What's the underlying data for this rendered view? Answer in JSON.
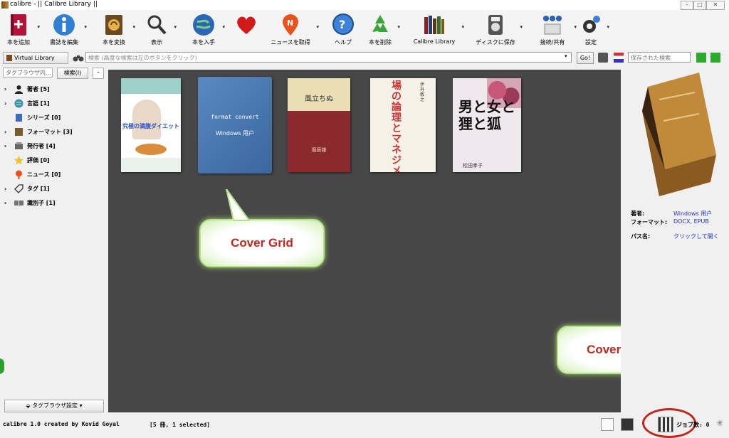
{
  "window": {
    "title": "calibre - || Calibre Library ||",
    "controls": [
      "–",
      "□",
      "✕"
    ]
  },
  "toolbar": {
    "items": [
      {
        "label": "本を追加",
        "icon": "add-book-icon"
      },
      {
        "label": "書誌を編集",
        "icon": "edit-metadata-icon"
      },
      {
        "label": "本を変換",
        "icon": "convert-book-icon"
      },
      {
        "label": "表示",
        "icon": "view-icon"
      },
      {
        "label": "本を入手",
        "icon": "get-books-icon"
      },
      {
        "label": "",
        "icon": "heart-icon"
      },
      {
        "label": "ニュースを取得",
        "icon": "fetch-news-icon"
      },
      {
        "label": "ヘルプ",
        "icon": "help-icon"
      },
      {
        "label": "本を削除",
        "icon": "remove-books-icon"
      },
      {
        "label": "Calibre Library",
        "icon": "library-icon"
      },
      {
        "label": "ディスクに保存",
        "icon": "save-to-disk-icon"
      },
      {
        "label": "接続/共有",
        "icon": "connect-share-icon"
      },
      {
        "label": "設定",
        "icon": "preferences-icon"
      }
    ]
  },
  "searchbar": {
    "virtual_library": "Virtual Library",
    "search_placeholder": "検索 (高度な検索は左のボタンをクリック)",
    "go": "Go!",
    "saved_searches": "保存された検索"
  },
  "tag_browser": {
    "find_placeholder": "タグブラウザ内...",
    "find_button": "検索(I)",
    "collapse": "-",
    "categories": [
      {
        "label": "著者",
        "count": "[5]",
        "expandable": true,
        "icon": "author-icon"
      },
      {
        "label": "言語",
        "count": "[1]",
        "expandable": true,
        "icon": "language-icon"
      },
      {
        "label": "シリーズ",
        "count": "[0]",
        "expandable": false,
        "icon": "series-icon"
      },
      {
        "label": "フォーマット",
        "count": "[3]",
        "expandable": true,
        "icon": "format-icon"
      },
      {
        "label": "発行者",
        "count": "[4]",
        "expandable": true,
        "icon": "publisher-icon"
      },
      {
        "label": "評価",
        "count": "[0]",
        "expandable": false,
        "icon": "rating-icon"
      },
      {
        "label": "ニュース",
        "count": "[0]",
        "expandable": false,
        "icon": "news-icon"
      },
      {
        "label": "タグ",
        "count": "[1]",
        "expandable": true,
        "icon": "tag-icon"
      },
      {
        "label": "識別子",
        "count": "[1]",
        "expandable": true,
        "icon": "identifier-icon"
      }
    ],
    "settings_button": "タグブラウザ設定"
  },
  "covers": [
    {
      "title": "究極の満腹ダイエット",
      "style": "photo-diet"
    },
    {
      "title": "format convert",
      "author": "Windows 用户",
      "style": "blue-placeholder"
    },
    {
      "title": "風立ちぬ",
      "author": "堀辰雄",
      "style": "red-classic"
    },
    {
      "title": "場の論理とマネジメント",
      "author": "伊丹敬之",
      "style": "beige-text"
    },
    {
      "title": "男と女と狸と狐",
      "author": "松田孝子",
      "style": "floral"
    }
  ],
  "book_details": {
    "rows": [
      {
        "key": "著者:",
        "value": "Windows 用户"
      },
      {
        "key": "フォーマット:",
        "value": "DOCX, EPUB"
      },
      {
        "key": "パス名:",
        "value": "クリックして開く"
      }
    ]
  },
  "status": {
    "left": "calibre 1.0 created by Kovid Goyal",
    "center": "[5 冊, 1 selected]",
    "jobs": "ジョブ数: 0"
  },
  "callouts": {
    "grid_label": "Cover Grid",
    "status_label": "Cover Grid"
  },
  "colors": {
    "grid_bg": "#474747",
    "callout_text": "#c0271d",
    "callout_glow": "#9fd86a",
    "link": "#2233cc"
  }
}
